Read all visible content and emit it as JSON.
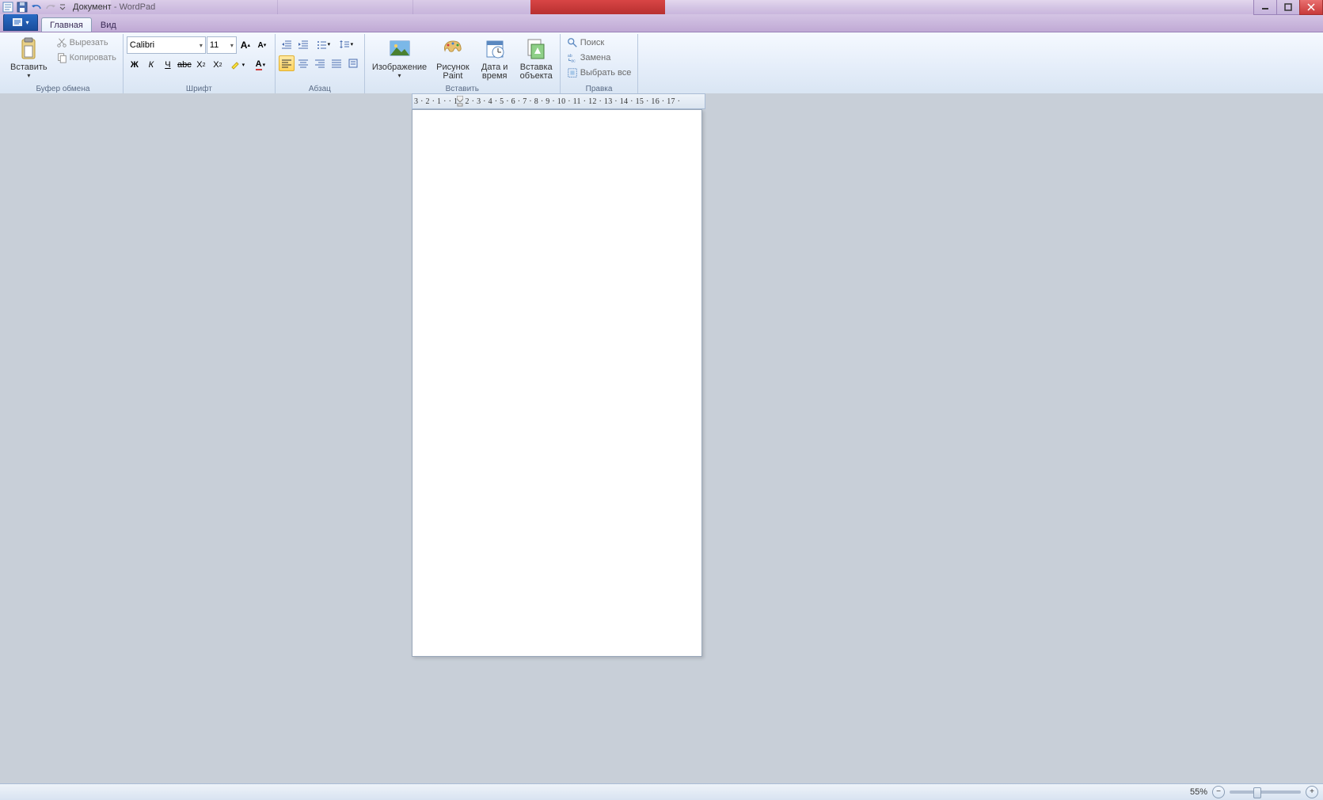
{
  "title": "Документ - WordPad",
  "tabs": {
    "home": "Главная",
    "view": "Вид"
  },
  "clipboard": {
    "paste": "Вставить",
    "cut": "Вырезать",
    "copy": "Копировать",
    "group": "Буфер обмена"
  },
  "font": {
    "name": "Calibri",
    "size": "11",
    "group": "Шрифт"
  },
  "paragraph": {
    "group": "Абзац"
  },
  "insert": {
    "image": "Изображение",
    "paint": "Рисунок\nPaint",
    "paint1": "Рисунок",
    "paint2": "Paint",
    "datetime1": "Дата и",
    "datetime2": "время",
    "object1": "Вставка",
    "object2": "объекта",
    "group": "Вставить"
  },
  "editing": {
    "find": "Поиск",
    "replace": "Замена",
    "selectall": "Выбрать все",
    "group": "Правка"
  },
  "ruler_marks": "3 · 2 · 1 ·   · 1 · 2 · 3 · 4 · 5 · 6 · 7 · 8 · 9 · 10 · 11 · 12 · 13 · 14 · 15 · 16 · 17 ·",
  "zoom": "55%"
}
